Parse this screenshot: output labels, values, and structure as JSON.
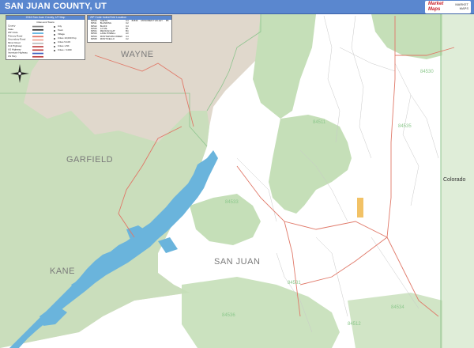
{
  "header": {
    "title": "SAN JUAN COUNTY, UT",
    "brand_logo": "Market Maps",
    "brand_sub": "MARKET MAPS"
  },
  "legend": {
    "title": "2016 San Juan County, UT Map",
    "subtitle": "Cities and Towns",
    "left_items": [
      {
        "label": "County",
        "color": "#888888"
      },
      {
        "label": "State",
        "color": "#333333"
      },
      {
        "label": "ZIP Code",
        "color": "#5ab0e0"
      },
      {
        "label": "Primary Road",
        "color": "#e07060"
      },
      {
        "label": "Secondary Road",
        "color": "#f0a090"
      },
      {
        "label": "Minor Road",
        "color": "#bbbbbb"
      },
      {
        "label": "Unit Highway",
        "color": "#c04040"
      },
      {
        "label": "US Highway",
        "color": "#c04040"
      },
      {
        "label": "Interstate Highway",
        "color": "#4060c0"
      },
      {
        "label": "US Hwy",
        "color": "#c04040"
      }
    ],
    "right_items": [
      {
        "label": "City"
      },
      {
        "label": "Town"
      },
      {
        "label": "Village"
      },
      {
        "label": "Cities 10,000 Pop"
      },
      {
        "label": "Cities 5-10K"
      },
      {
        "label": "Cities 1-5K"
      },
      {
        "label": "Cities < 1000"
      }
    ]
  },
  "zip_table": {
    "title": "ZIP Code Index/Grid Location",
    "rows": [
      [
        "84510",
        "ANETH",
        "C4",
        "84536",
        "MONUMENT VALLEY",
        "B5"
      ],
      [
        "84511",
        "BLANDING",
        "C2",
        "",
        "",
        ""
      ],
      [
        "84512",
        "BLUFF",
        "C4",
        "",
        "",
        ""
      ],
      [
        "84530",
        "LA SAL",
        "B1",
        "",
        "",
        ""
      ],
      [
        "84531",
        "MEXICAN HAT",
        "B4",
        "",
        "",
        ""
      ],
      [
        "84533",
        "LAKE POWELL",
        "A3",
        "",
        "",
        ""
      ],
      [
        "84534",
        "MONTEZUMA CREEK",
        "C4",
        "",
        "",
        ""
      ],
      [
        "84535",
        "MONTICELLO",
        "C2",
        "",
        "",
        ""
      ]
    ]
  },
  "map": {
    "county_labels": [
      {
        "name": "WAYNE"
      },
      {
        "name": "GARFIELD"
      },
      {
        "name": "KANE"
      },
      {
        "name": "SAN JUAN"
      }
    ],
    "state_label": "Colorado",
    "zip_labels": [
      "84530",
      "84511",
      "84535",
      "84533",
      "84531",
      "84536",
      "84534",
      "84512"
    ],
    "colors": {
      "neighbor_county": "#e0d8cc",
      "forest": "#c5dfb8",
      "water": "#6ab4dc",
      "highway": "#e07868",
      "minor_road": "#c8c8c8",
      "boundary": "#8ec48e",
      "header": "#5a87cf"
    }
  }
}
